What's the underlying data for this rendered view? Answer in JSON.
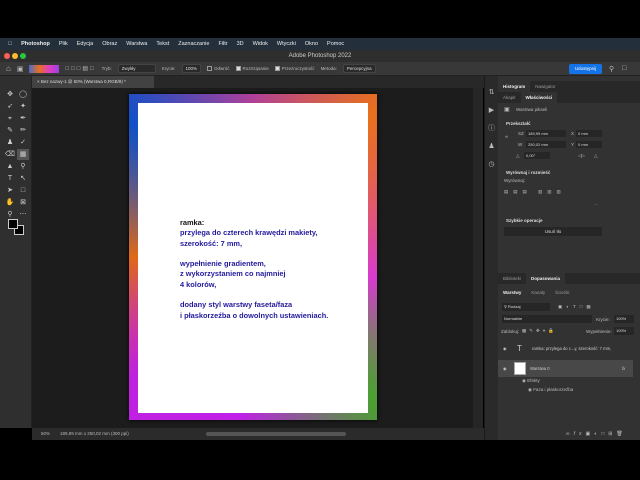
{
  "menu": {
    "apple": "apple-icon",
    "items": [
      "Photoshop",
      "Plik",
      "Edycja",
      "Obraz",
      "Warstwa",
      "Tekst",
      "Zaznaczanie",
      "Filtr",
      "3D",
      "Widok",
      "Wtyczki",
      "Okno",
      "Pomoc"
    ]
  },
  "window_title": "Adobe Photoshop 2022",
  "options": {
    "tryb_label": "Tryb:",
    "tryb_value": "Zwykły",
    "krycie_label": "Krycie:",
    "krycie_value": "100%",
    "odwroc": "Odwróć",
    "roztrzasanie": "Roztrząsanie",
    "przezroczystosc": "Przezroczystość",
    "metoda_label": "Metoda:",
    "metoda_value": "Percepcyjna",
    "share": "Udostępnij"
  },
  "document_tab": "Bez nazwy-1 @ 50% (Warstwa 0,RGB/8) *",
  "canvas_text": {
    "line1": "ramka:",
    "rest": "przylega do czterech krawędzi makiety,\nszerokość: 7 mm,\n\nwypełnienie gradientem,\nz wykorzystaniem co najmniej\n4 kolorów,\n\ndodany styl warstwy faseta/faza\ni płaskorzeźba o dowolnych ustawieniach."
  },
  "frame_colors": {
    "top_left": "#1050c8",
    "top_right": "#e8701c",
    "bottom_left": "#c020e0",
    "bottom_right": "#4aa030"
  },
  "status": {
    "zoom": "50%",
    "doc_info": "189,99 mm x 250,02 mm (300 ppi)"
  },
  "panels": {
    "top_tabs": [
      "Histogram",
      "Nawigator"
    ],
    "prop_tabs": [
      "Akapit",
      "Właściwości"
    ],
    "layer_type": "Warstwa pikseli",
    "transform": {
      "title": "Przekształć",
      "w_label": "SZ",
      "w": "189,99 mm",
      "h_label": "W",
      "h": "250,02 mm",
      "x_label": "X",
      "x": "0 mm",
      "y_label": "Y",
      "y": "0 mm",
      "angle": "0,00°"
    },
    "align": {
      "title": "Wyrównaj i rozmieść",
      "sub": "Wyrównaj:",
      "more": "..."
    },
    "quick": {
      "title": "Szybkie operacje",
      "button": "Usuń tło"
    },
    "lib_tabs": [
      "Biblioteki",
      "Dopasowania"
    ],
    "layer_tabs": [
      "Warstwy",
      "Kanały",
      "Ścieżki"
    ],
    "filter": "Rodzaj",
    "blend": "Normalnie",
    "opacity_label": "Krycie:",
    "opacity": "100%",
    "lock_label": "Zablokuj:",
    "fill_label": "Wypełnienie:",
    "fill": "100%",
    "layers": [
      {
        "name": "ramka: przylega do c...y, szerokość: 7 mm,",
        "type": "text"
      },
      {
        "name": "Warstwa 0",
        "type": "pixel",
        "fx": "fx"
      }
    ],
    "effects": "Efekty",
    "effect1": "Faza i płaskorzeźba"
  }
}
